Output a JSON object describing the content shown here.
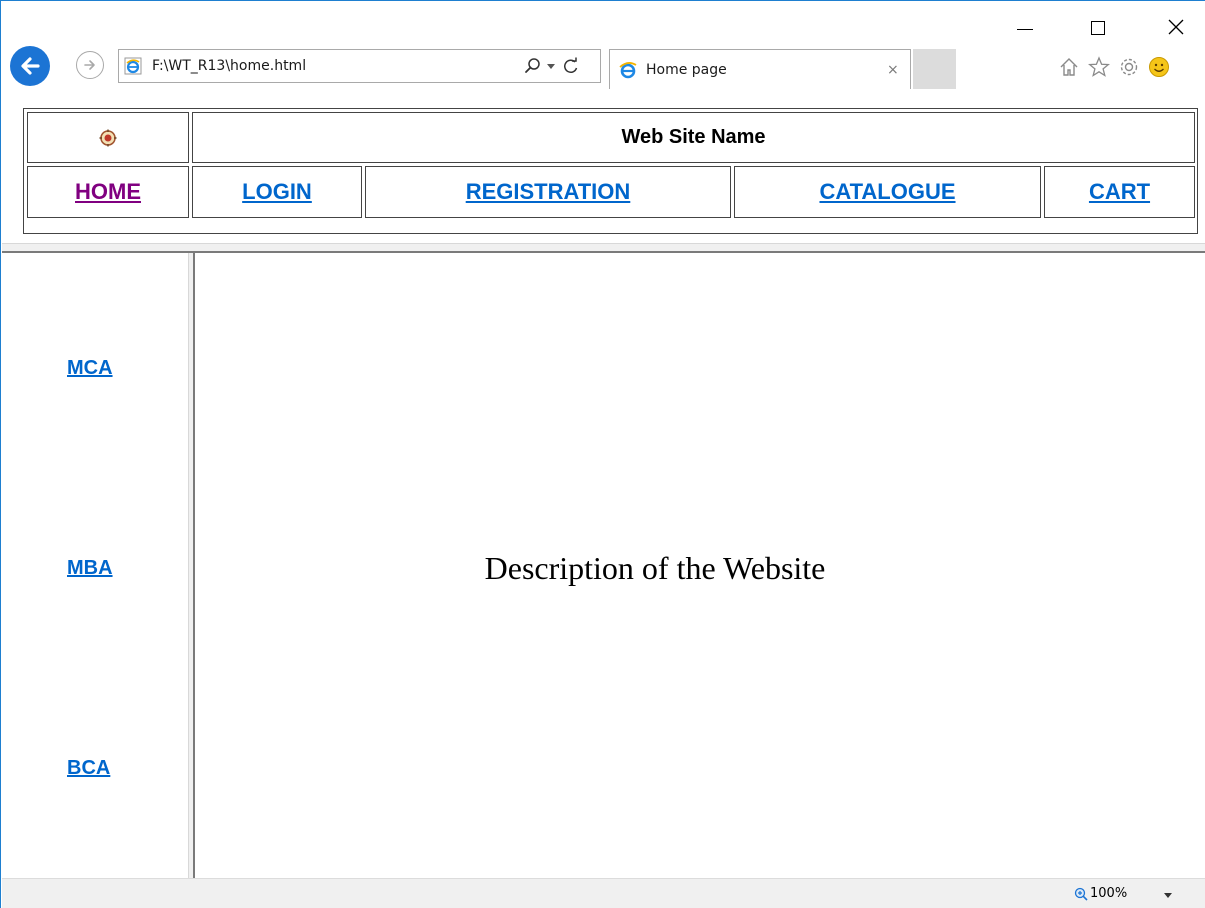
{
  "browser": {
    "address": "F:\\WT_R13\\home.html",
    "tab_title": "Home page",
    "tab_close": "×"
  },
  "header": {
    "site_name": "Web Site Name"
  },
  "nav": {
    "home": "HOME",
    "login": "LOGIN",
    "registration": "REGISTRATION",
    "catalogue": "CATALOGUE",
    "cart": "CART"
  },
  "sidebar": {
    "items": [
      "MCA",
      "MBA",
      "BCA"
    ]
  },
  "main": {
    "description": "Description of the Website"
  },
  "status": {
    "zoom": "100%"
  },
  "colors": {
    "link": "#0066cc",
    "visited_link": "#800080",
    "accent": "#1c74d4"
  }
}
